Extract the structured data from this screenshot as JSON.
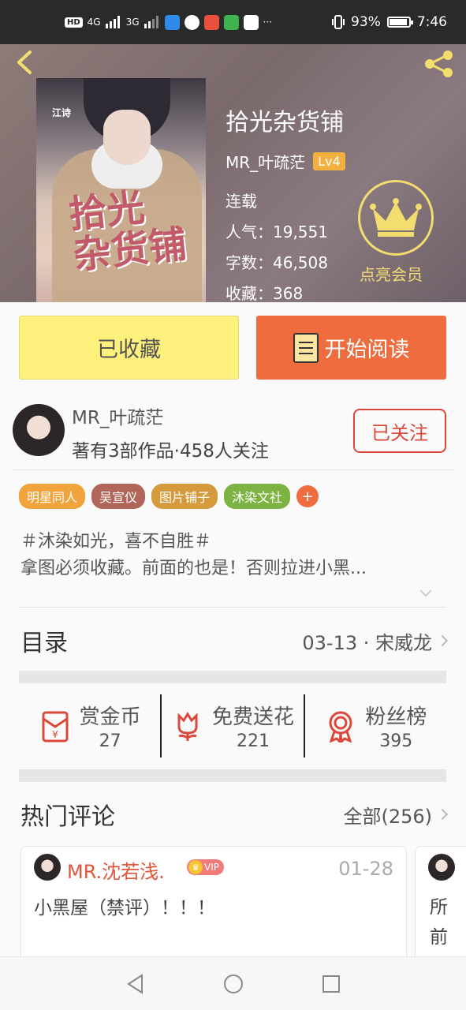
{
  "status_bar": {
    "left_indicators": [
      "HD",
      "4G",
      "3G"
    ],
    "battery": "93%",
    "time": "7:46",
    "more": "···"
  },
  "book": {
    "title": "拾光杂货铺",
    "author": "MR_叶疏茫",
    "level": "Lv4",
    "status": "连载",
    "popularity_label": "人气：",
    "popularity": "19,551",
    "words_label": "字数：",
    "words": "46,508",
    "favorites_label": "收藏：",
    "favorites": "368",
    "cover_title": "拾光\n杂货铺",
    "cover_logo": "江诗"
  },
  "membership": {
    "label": "点亮会员"
  },
  "actions": {
    "collected_label": "已收藏",
    "read_label": "开始阅读"
  },
  "author_card": {
    "name": "MR_叶疏茫",
    "summary": "著有3部作品·458人关注",
    "follow_label": "已关注"
  },
  "tags": [
    {
      "label": "明星同人",
      "color": "#f2a43c"
    },
    {
      "label": "吴宣仪",
      "color": "#b0675a"
    },
    {
      "label": "图片铺子",
      "color": "#d49a3c"
    },
    {
      "label": "沐染文社",
      "color": "#7cb342"
    }
  ],
  "tag_add_label": "+",
  "description": {
    "line1": "＃沐染如光，喜不自胜＃",
    "line2": "拿图必须收藏。前面的也是！否则拉进小黑..."
  },
  "toc": {
    "title": "目录",
    "latest": "03-13 · 宋威龙"
  },
  "stats": [
    {
      "label": "赏金币",
      "value": "27",
      "icon": "red-envelope-icon"
    },
    {
      "label": "免费送花",
      "value": "221",
      "icon": "flower-icon"
    },
    {
      "label": "粉丝榜",
      "value": "395",
      "icon": "medal-icon"
    }
  ],
  "comments": {
    "title": "热门评论",
    "all_label": "全部(256)",
    "items": [
      {
        "user": "MR.沈若浅.",
        "vip": "VIP",
        "date": "01-28",
        "text": "小黑屋（禁评）！！！"
      },
      {
        "text": "所前元"
      }
    ]
  },
  "colors": {
    "accent": "#ee6c3d",
    "collected_bg": "#fdf07c",
    "follow": "#d9483b",
    "vip_gold": "#f4dd6f"
  }
}
